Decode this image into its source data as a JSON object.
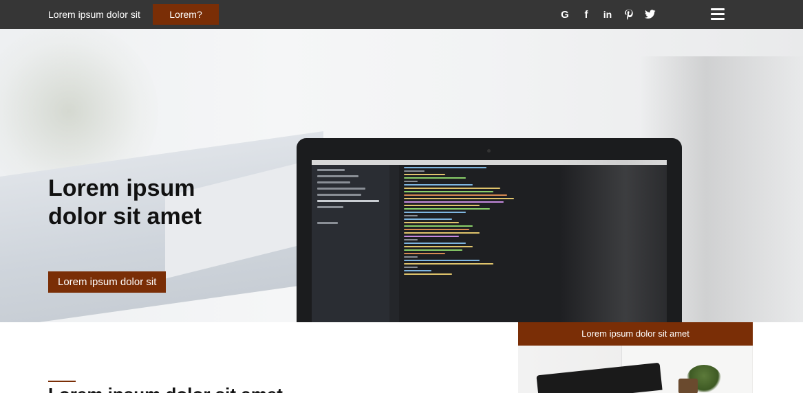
{
  "nav": {
    "brand": "Lorem ipsum dolor sit",
    "cta": "Lorem?",
    "social": [
      {
        "icon": "google-icon",
        "glyph": "G"
      },
      {
        "icon": "facebook-icon",
        "glyph": "f"
      },
      {
        "icon": "linkedin-icon",
        "glyph": "in"
      },
      {
        "icon": "pinterest-icon",
        "glyph": "P"
      },
      {
        "icon": "twitter-icon",
        "glyph": ""
      }
    ],
    "menu_icon": "hamburger-menu-icon"
  },
  "hero": {
    "title": "Lorem ipsum\ndolor sit amet",
    "cta": "Lorem ipsum dolor sit"
  },
  "card": {
    "header": "Lorem ipsum dolor sit amet"
  },
  "section": {
    "title": "Lorem ipsum dolor sit amet"
  },
  "colors": {
    "topbar": "#363636",
    "accent": "#7a2e06",
    "text_dark": "#111111"
  }
}
